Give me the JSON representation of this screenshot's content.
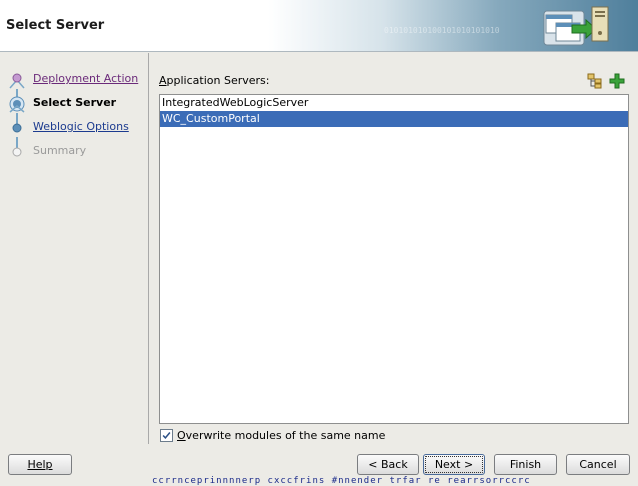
{
  "header": {
    "title": "Select Server",
    "binary_text": "010101010100101010101010"
  },
  "nav": {
    "items": [
      {
        "label": "Deployment Action",
        "state": "visited"
      },
      {
        "label": "Select Server",
        "state": "current"
      },
      {
        "label": "Weblogic Options",
        "state": "link"
      },
      {
        "label": "Summary",
        "state": "disabled"
      }
    ]
  },
  "main": {
    "servers_label": "Application Servers:",
    "servers_label_mnemonic": "A",
    "servers_label_rest": "pplication Servers:",
    "servers": [
      {
        "name": "IntegratedWebLogicServer",
        "selected": false
      },
      {
        "name": "WC_CustomPortal",
        "selected": true
      }
    ],
    "overwrite": {
      "checked": true,
      "mnemonic": "O",
      "label_rest": "verwrite modules of the same name"
    }
  },
  "buttons": {
    "help": "Help",
    "back": "< Back",
    "next": "Next >",
    "finish": "Finish",
    "cancel": "Cancel"
  },
  "background_strip_text": "ccrrnceprinnnnerp cxccfrins #nnender trfar re rearrsorrccrc",
  "icons": {
    "header_art": "windows-server-arrow-icon",
    "browse_servers": "server-tree-icon",
    "add_server": "green-plus-icon"
  },
  "colors": {
    "selection": "#3b6cb7",
    "visited_link": "#6b2a7a",
    "link": "#1c3b8f",
    "train_line": "#7aa7c7"
  }
}
